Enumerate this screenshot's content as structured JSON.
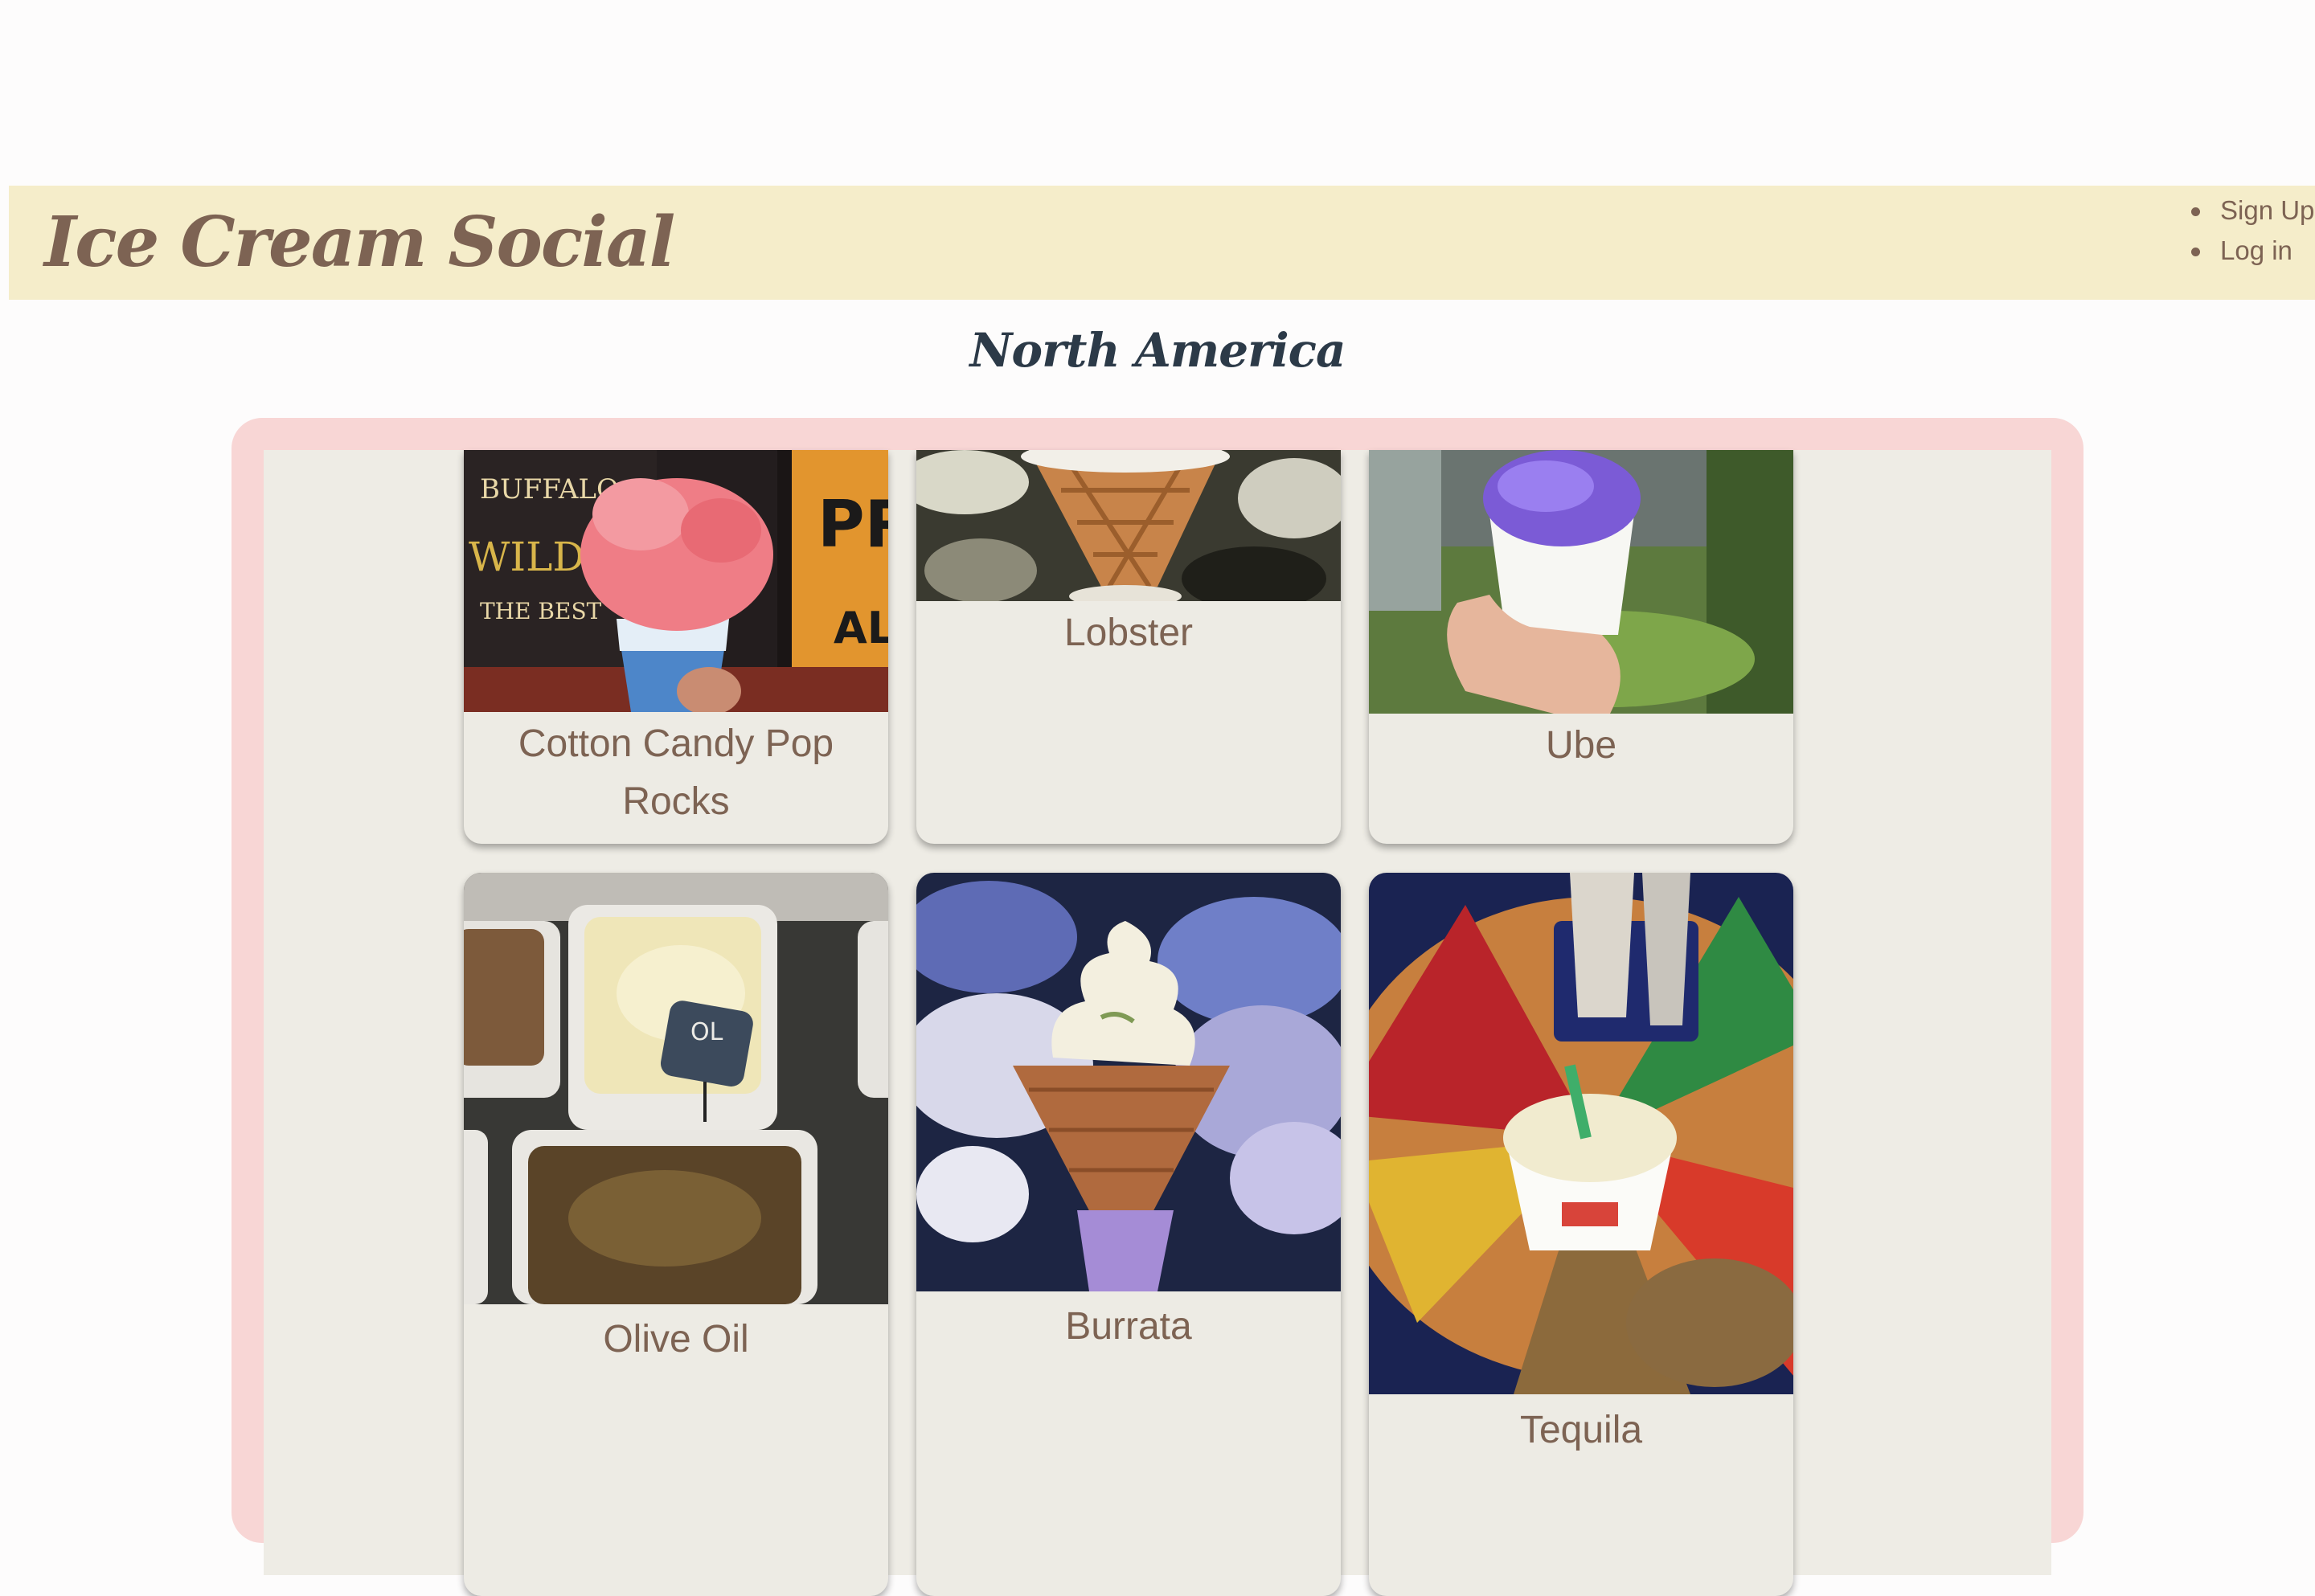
{
  "header": {
    "title": "Ice Cream Social",
    "nav": [
      "Sign Up",
      "Log in"
    ]
  },
  "region": {
    "title": "North America"
  },
  "flavors": [
    {
      "name": "Cotton Candy Pop Rocks",
      "photo": "cotton-candy-cone-photo"
    },
    {
      "name": "Lobster",
      "photo": "waffle-cone-photo"
    },
    {
      "name": "Ube",
      "photo": "purple-scoop-cup-photo"
    },
    {
      "name": "Olive Oil",
      "photo": "gelato-tubs-photo"
    },
    {
      "name": "Burrata",
      "photo": "soft-serve-cone-photo"
    },
    {
      "name": "Tequila",
      "photo": "cup-on-table-photo"
    }
  ],
  "colors": {
    "header_bg": "#f5edca",
    "brand_text": "#7d6353",
    "region_title": "#2c3a48",
    "frame": "#f8d6d5",
    "panel": "#eeece5"
  }
}
